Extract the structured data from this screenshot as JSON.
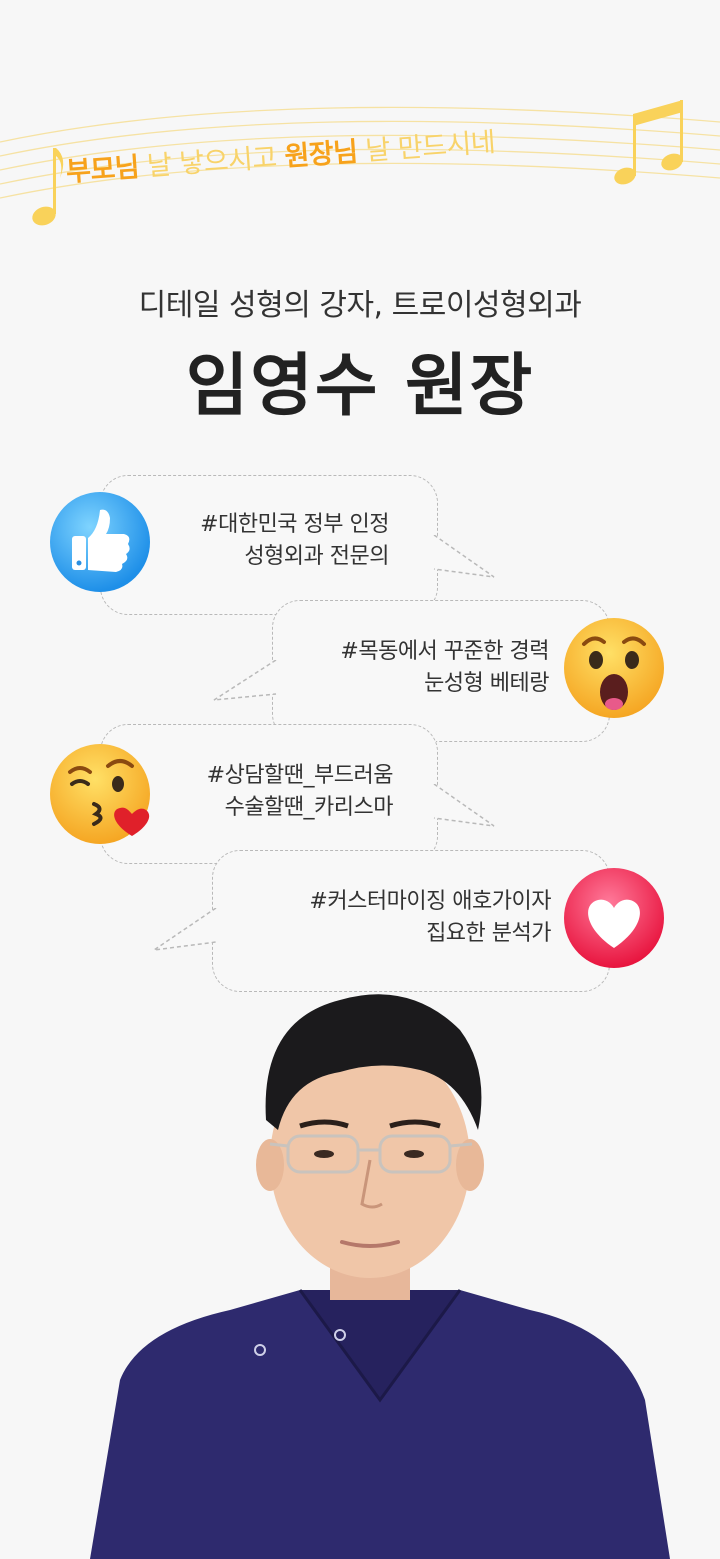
{
  "banner": {
    "part1": "부모님",
    "part2": " 날 낳으시고 ",
    "part3": "원장님",
    "part4": " 날 만드시네"
  },
  "header": {
    "subtitle": "디테일 성형의 강자, 트로이성형외과",
    "name": "임영수 원장"
  },
  "bubbles": [
    {
      "line1": "#대한민국 정부 인정",
      "line2": "성형외과 전문의",
      "icon": "thumbs-up-icon"
    },
    {
      "line1": "#목동에서 꾸준한 경력",
      "line2": "눈성형 베테랑",
      "icon": "surprised-face-icon"
    },
    {
      "line1": "#상담할땐_부드러움",
      "line2": "수술할땐_카리스마",
      "icon": "kiss-face-icon"
    },
    {
      "line1": "#커스터마이징 애호가이자",
      "line2": "집요한 분석가",
      "icon": "heart-icon"
    }
  ],
  "colors": {
    "accent": "#f7a21b",
    "pale_accent": "#f8d36a",
    "scrub": "#2e2a6e"
  }
}
